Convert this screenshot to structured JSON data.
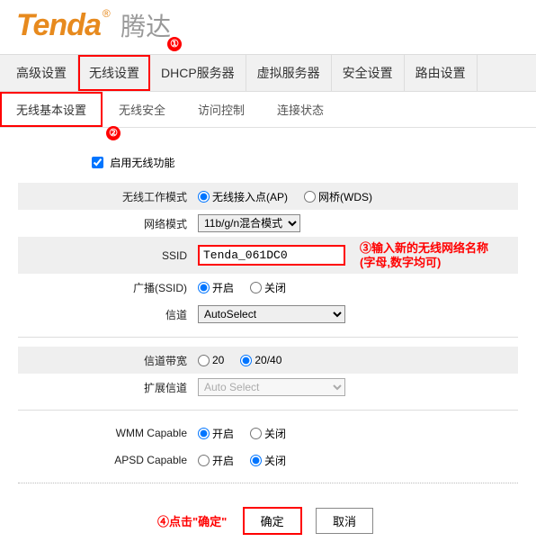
{
  "logo": {
    "brand": "Tenda",
    "cn": "腾达"
  },
  "main_nav": [
    "高级设置",
    "无线设置",
    "DHCP服务器",
    "虚拟服务器",
    "安全设置",
    "路由设置"
  ],
  "sub_nav": [
    "无线基本设置",
    "无线安全",
    "访问控制",
    "连接状态"
  ],
  "anno": {
    "a1": "①",
    "a2": "②",
    "a3": "③输入新的无线网络名称",
    "a3b": "(字母,数字均可)",
    "a4": "④点击\"确定\""
  },
  "enable_label": "启用无线功能",
  "rows": {
    "mode_label": "无线工作模式",
    "mode_opt1": "无线接入点(AP)",
    "mode_opt2": "网桥(WDS)",
    "netmode_label": "网络模式",
    "netmode_val": "11b/g/n混合模式",
    "ssid_label": "SSID",
    "ssid_val": "Tenda_061DC0",
    "broadcast_label": "广播(SSID)",
    "on": "开启",
    "off": "关闭",
    "channel_label": "信道",
    "channel_val": "AutoSelect",
    "bw_label": "信道带宽",
    "bw_opt1": "20",
    "bw_opt2": "20/40",
    "ext_label": "扩展信道",
    "ext_val": "Auto Select",
    "wmm_label": "WMM Capable",
    "apsd_label": "APSD Capable"
  },
  "buttons": {
    "ok": "确定",
    "cancel": "取消"
  }
}
